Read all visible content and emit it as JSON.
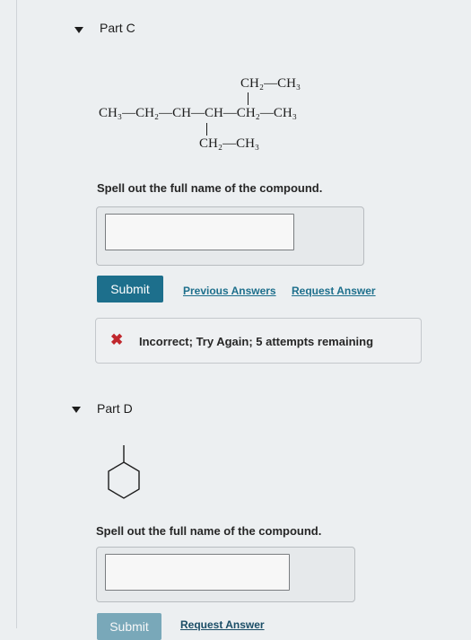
{
  "partC": {
    "title": "Part C",
    "structure": {
      "top_branch": "CH₂—CH₃",
      "main_chain": "CH₃—CH₂—CH—CH—CH₂—CH₃",
      "bottom_branch": "CH₂—CH₃"
    },
    "prompt": "Spell out the full name of the compound.",
    "answer_value": "",
    "submit_label": "Submit",
    "previous_answers_label": "Previous Answers",
    "request_answer_label": "Request Answer",
    "feedback": {
      "icon": "x-icon",
      "text": "Incorrect; Try Again; 5 attempts remaining",
      "color": "#c0272d"
    }
  },
  "partD": {
    "title": "Part D",
    "structure_icon": "methylcyclohexane-skeletal-structure",
    "prompt": "Spell out the full name of the compound.",
    "answer_value": "",
    "submit_label": "Submit",
    "request_answer_label": "Request Answer"
  },
  "colors": {
    "accent": "#1d6f8c",
    "error": "#c0272d"
  }
}
